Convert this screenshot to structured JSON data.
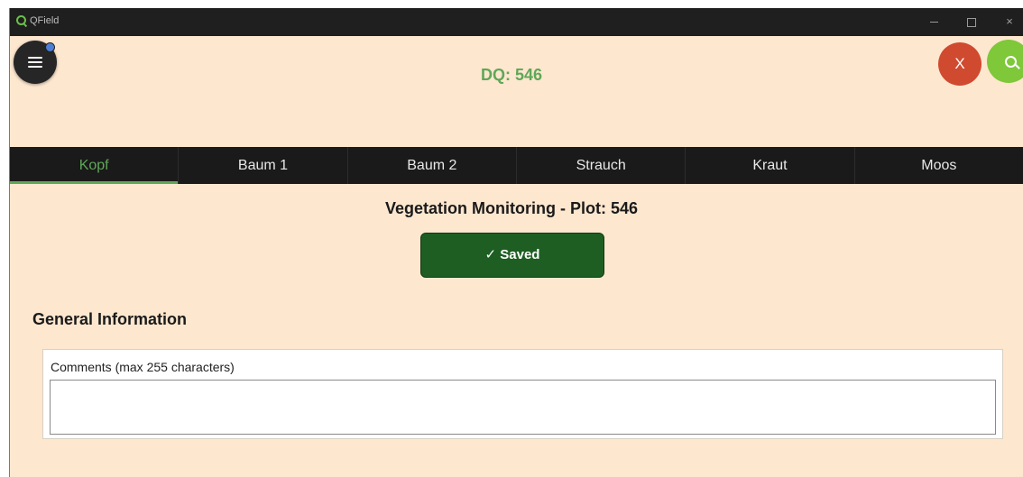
{
  "window": {
    "title": "QField",
    "controls": {
      "minimize": "minimize",
      "maximize": "maximize",
      "close": "×"
    }
  },
  "header": {
    "menu_icon": "hamburger-menu-icon",
    "form_title": "DQ: 546",
    "cancel_label": "X",
    "search_icon": "search-icon"
  },
  "tabs": [
    {
      "label": "Kopf",
      "active": true
    },
    {
      "label": "Baum 1",
      "active": false
    },
    {
      "label": "Baum 2",
      "active": false
    },
    {
      "label": "Strauch",
      "active": false
    },
    {
      "label": "Kraut",
      "active": false
    },
    {
      "label": "Moos",
      "active": false
    }
  ],
  "content": {
    "section_title": "Vegetation Monitoring - Plot: 546",
    "saved_label": "✓ Saved",
    "group_title": "General Information",
    "comments": {
      "label": "Comments (max 255 characters)",
      "value": "",
      "placeholder": ""
    }
  },
  "colors": {
    "background": "#fde7cf",
    "accent_green": "#5fa758",
    "saved_green": "#1e5e22",
    "cancel_red": "#d04a2f",
    "search_green": "#7ec83a",
    "tabbar": "#1a1a1a"
  }
}
